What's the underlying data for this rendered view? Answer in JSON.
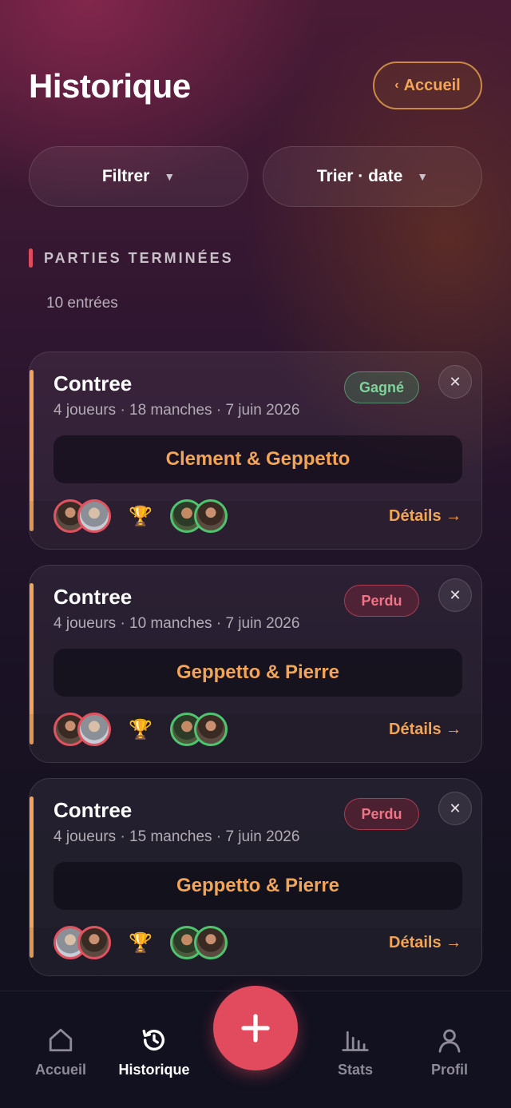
{
  "header": {
    "title": "Historique",
    "back_label": "Accueil"
  },
  "filters": {
    "filter_label": "Filtrer",
    "sort_label": "Trier · date"
  },
  "section": {
    "title": "PARTIES TERMINÉES",
    "count": "10 entrées"
  },
  "games": [
    {
      "title": "Contree",
      "meta": "4 joueurs · 18 manches · 7 juin 2026",
      "result": "Gagné",
      "result_type": "win",
      "winners": "Clement & Geppetto",
      "details_label": "Détails →"
    },
    {
      "title": "Contree",
      "meta": "4 joueurs · 10 manches · 7 juin 2026",
      "result": "Perdu",
      "result_type": "lose",
      "winners": "Geppetto & Pierre",
      "details_label": "Détails →"
    },
    {
      "title": "Contree",
      "meta": "4 joueurs · 15 manches · 7 juin 2026",
      "result": "Perdu",
      "result_type": "lose",
      "winners": "Geppetto & Pierre",
      "details_label": "Détails →"
    }
  ],
  "nav": {
    "home": "Accueil",
    "history": "Historique",
    "stats": "Stats",
    "profile": "Profil"
  },
  "colors": {
    "accent_orange": "#f2a457",
    "accent_red": "#e24a5d",
    "win_green": "#7fd49a",
    "lose_red": "#f07486"
  }
}
